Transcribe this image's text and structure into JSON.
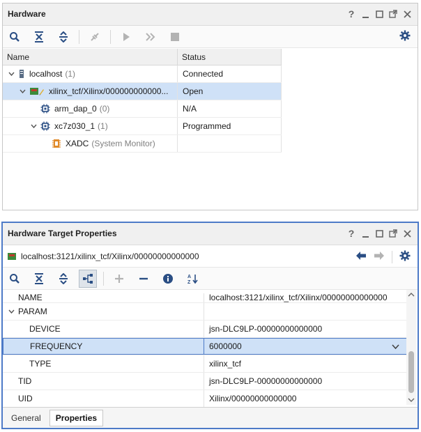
{
  "hardware": {
    "title": "Hardware",
    "columns": {
      "name": "Name",
      "status": "Status"
    },
    "rows": [
      {
        "name": "localhost",
        "count": "(1)",
        "status": "Connected"
      },
      {
        "name": "xilinx_tcf/Xilinx/000000000000...",
        "count": "",
        "status": "Open"
      },
      {
        "name": "arm_dap_0",
        "count": "(0)",
        "status": "N/A"
      },
      {
        "name": "xc7z030_1",
        "count": "(1)",
        "status": "Programmed"
      },
      {
        "name": "XADC",
        "count": "(System Monitor)",
        "status": ""
      }
    ]
  },
  "properties": {
    "title": "Hardware Target Properties",
    "path": "localhost:3121/xilinx_tcf/Xilinx/00000000000000",
    "rows": [
      {
        "name": "NAME",
        "value": "localhost:3121/xilinx_tcf/Xilinx/00000000000000"
      },
      {
        "name": "PARAM",
        "value": ""
      },
      {
        "name": "DEVICE",
        "value": "jsn-DLC9LP-00000000000000"
      },
      {
        "name": "FREQUENCY",
        "value": "6000000"
      },
      {
        "name": "TYPE",
        "value": "xilinx_tcf"
      },
      {
        "name": "TID",
        "value": "jsn-DLC9LP-00000000000000"
      },
      {
        "name": "UID",
        "value": "Xilinx/00000000000000"
      }
    ],
    "tabs": {
      "general": "General",
      "properties": "Properties"
    }
  },
  "window_controls": {
    "help": "?"
  },
  "colors": {
    "accent": "#4d7ac7",
    "selection": "#cfe1f7",
    "toolbar_icon": "#2a4e84",
    "disabled_icon": "#b3b3b3"
  }
}
